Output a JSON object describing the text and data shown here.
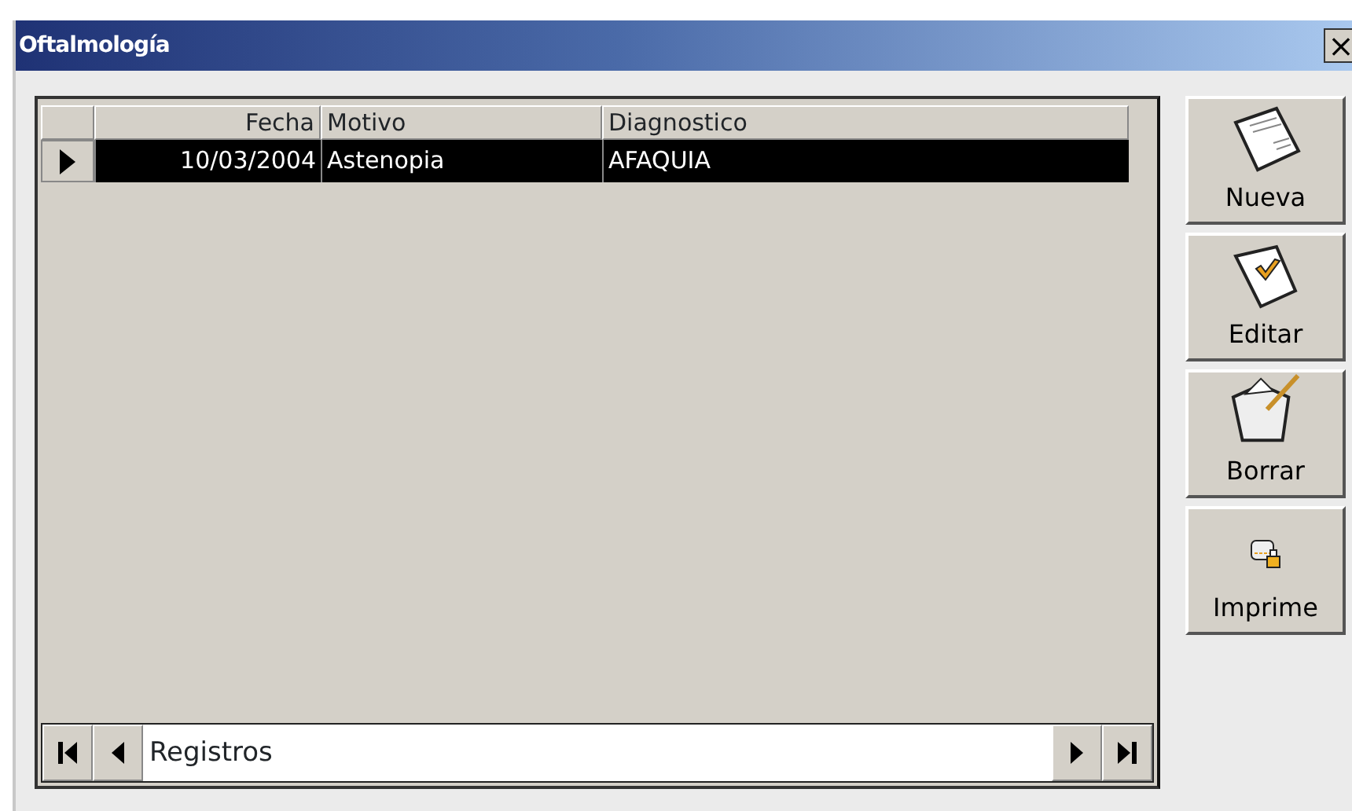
{
  "window": {
    "title": "Oftalmología",
    "close": "×"
  },
  "table": {
    "columns": [
      "Fecha",
      "Motivo",
      "Diagnostico"
    ],
    "rows": [
      {
        "cells": [
          "10/03/2004",
          "Astenopia",
          "AFAQUIA"
        ],
        "selected": true
      }
    ]
  },
  "navigator": {
    "label": "Registros"
  },
  "buttons": [
    {
      "label": "Nueva",
      "kind": "new"
    },
    {
      "label": "Editar",
      "kind": "edit"
    },
    {
      "label": "Borrar",
      "kind": "delete"
    },
    {
      "label": "Imprime",
      "kind": "print"
    }
  ]
}
